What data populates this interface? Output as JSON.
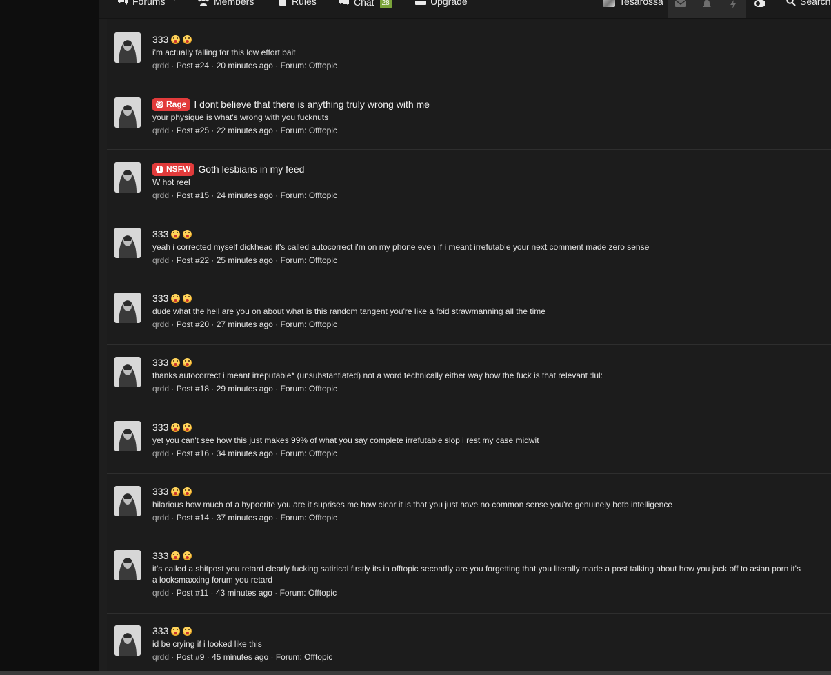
{
  "nav": {
    "forums": "Forums",
    "members": "Members",
    "rules": "Rules",
    "chat": "Chat",
    "chat_count": "28",
    "upgrade": "Upgrade",
    "username": "Tesarossa",
    "search": "Search"
  },
  "colors": {
    "rage_badge": "#e23b3b",
    "nsfw_badge": "#e23b3b",
    "chat_badge": "#7aa33a"
  },
  "posts": [
    {
      "title": "333",
      "emoji": [
        "astonished-face-emoji",
        "astonished-face-emoji"
      ],
      "snippet": "i'm actually falling for this low effort bait",
      "author": "qrdd",
      "post": "Post #24",
      "time": "20 minutes ago",
      "forum_prefix": "Forum:",
      "forum": "Offtopic"
    },
    {
      "prefix": "Rage",
      "title": "I dont believe that there is anything truly wrong with me",
      "snippet": "your physique is what's wrong with you fucknuts",
      "author": "qrdd",
      "post": "Post #25",
      "time": "22 minutes ago",
      "forum_prefix": "Forum:",
      "forum": "Offtopic"
    },
    {
      "prefix": "NSFW",
      "title": "Goth lesbians in my feed",
      "snippet": "W hot reel",
      "author": "qrdd",
      "post": "Post #15",
      "time": "24 minutes ago",
      "forum_prefix": "Forum:",
      "forum": "Offtopic"
    },
    {
      "title": "333",
      "snippet": "yeah i corrected myself dickhead it's called autocorrect i'm on my phone even if i meant irrefutable your next comment made zero sense",
      "author": "qrdd",
      "post": "Post #22",
      "time": "25 minutes ago",
      "forum_prefix": "Forum:",
      "forum": "Offtopic"
    },
    {
      "title": "333",
      "snippet": "dude what the hell are you on about what is this random tangent you're like a foid strawmanning all the time",
      "author": "qrdd",
      "post": "Post #20",
      "time": "27 minutes ago",
      "forum_prefix": "Forum:",
      "forum": "Offtopic"
    },
    {
      "title": "333",
      "snippet": "thanks autocorrect i meant irreputable* (unsubstantiated) not a word technically either way how the fuck is that relevant :lul:",
      "author": "qrdd",
      "post": "Post #18",
      "time": "29 minutes ago",
      "forum_prefix": "Forum:",
      "forum": "Offtopic"
    },
    {
      "title": "333",
      "snippet": "yet you can't see how this just makes 99% of what you say complete irrefutable slop i rest my case midwit",
      "author": "qrdd",
      "post": "Post #16",
      "time": "34 minutes ago",
      "forum_prefix": "Forum:",
      "forum": "Offtopic"
    },
    {
      "title": "333",
      "snippet": "hilarious how much of a hypocrite you are it suprises me how clear it is that you just have no common sense you're genuinely botb intelligence",
      "author": "qrdd",
      "post": "Post #14",
      "time": "37 minutes ago",
      "forum_prefix": "Forum:",
      "forum": "Offtopic"
    },
    {
      "title": "333",
      "snippet": "it's called a shitpost you retard clearly fucking satirical firstly its in offtopic secondly are you forgetting that you literally made a post talking about how you jack off to asian porn it's a looksmaxxing forum you retard",
      "author": "qrdd",
      "post": "Post #11",
      "time": "43 minutes ago",
      "forum_prefix": "Forum:",
      "forum": "Offtopic"
    },
    {
      "title": "333",
      "snippet": "id be crying if i looked like this",
      "author": "qrdd",
      "post": "Post #9",
      "time": "45 minutes ago",
      "forum_prefix": "Forum:",
      "forum": "Offtopic"
    }
  ]
}
